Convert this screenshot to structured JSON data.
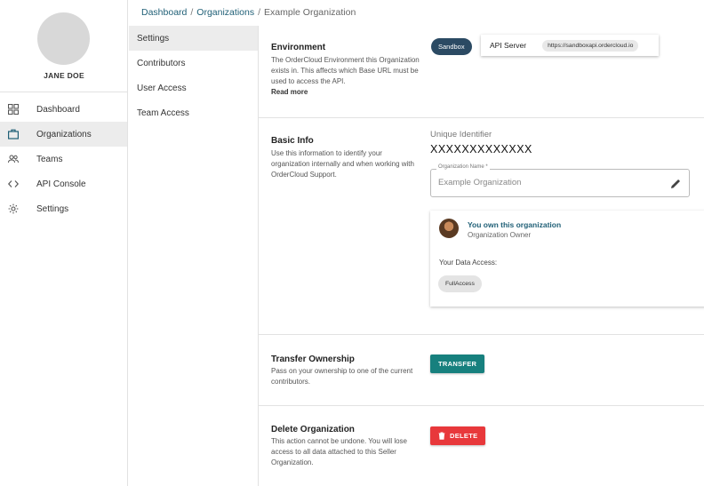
{
  "sidebar": {
    "user_name": "JANE DOE",
    "items": [
      {
        "label": "Dashboard",
        "icon": "grid-icon",
        "active": false
      },
      {
        "label": "Organizations",
        "icon": "briefcase-icon",
        "active": true
      },
      {
        "label": "Teams",
        "icon": "people-icon",
        "active": false
      },
      {
        "label": "API Console",
        "icon": "code-icon",
        "active": false
      },
      {
        "label": "Settings",
        "icon": "gear-icon",
        "active": false
      }
    ]
  },
  "breadcrumb": {
    "items": [
      "Dashboard",
      "Organizations",
      "Example Organization"
    ],
    "separator": "/"
  },
  "subnav": {
    "items": [
      {
        "label": "Settings",
        "active": true
      },
      {
        "label": "Contributors",
        "active": false
      },
      {
        "label": "User Access",
        "active": false
      },
      {
        "label": "Team Access",
        "active": false
      }
    ]
  },
  "environment": {
    "title": "Environment",
    "description": "The OrderCloud Environment this Organization exists in. This affects which Base URL must be used to access the API.",
    "read_more": "Read more",
    "env_chip": "Sandbox",
    "api_server_label": "API Server",
    "api_server_url": "https://sandboxapi.ordercloud.io"
  },
  "basic_info": {
    "title": "Basic Info",
    "description": "Use this information to identify your organization internally and when working with OrderCloud Support.",
    "uid_label": "Unique Identifier",
    "uid_value": "XXXXXXXXXXXXX",
    "org_name_label": "Organization Name *",
    "org_name_value": "Example Organization",
    "owner_title": "You own this organization",
    "owner_subtitle": "Organization Owner",
    "data_access_label": "Your Data Access:",
    "data_access_chip": "FullAccess"
  },
  "transfer": {
    "title": "Transfer Ownership",
    "description": "Pass on your ownership to one of the current contributors.",
    "button": "TRANSFER"
  },
  "delete": {
    "title": "Delete Organization",
    "description": "This action cannot be undone. You will lose access to all data attached to this Seller Organization.",
    "button": "DELETE"
  },
  "colors": {
    "brand": "#1f5f76",
    "env_chip": "#2b4a63",
    "transfer": "#17807e",
    "delete": "#e8383b"
  }
}
